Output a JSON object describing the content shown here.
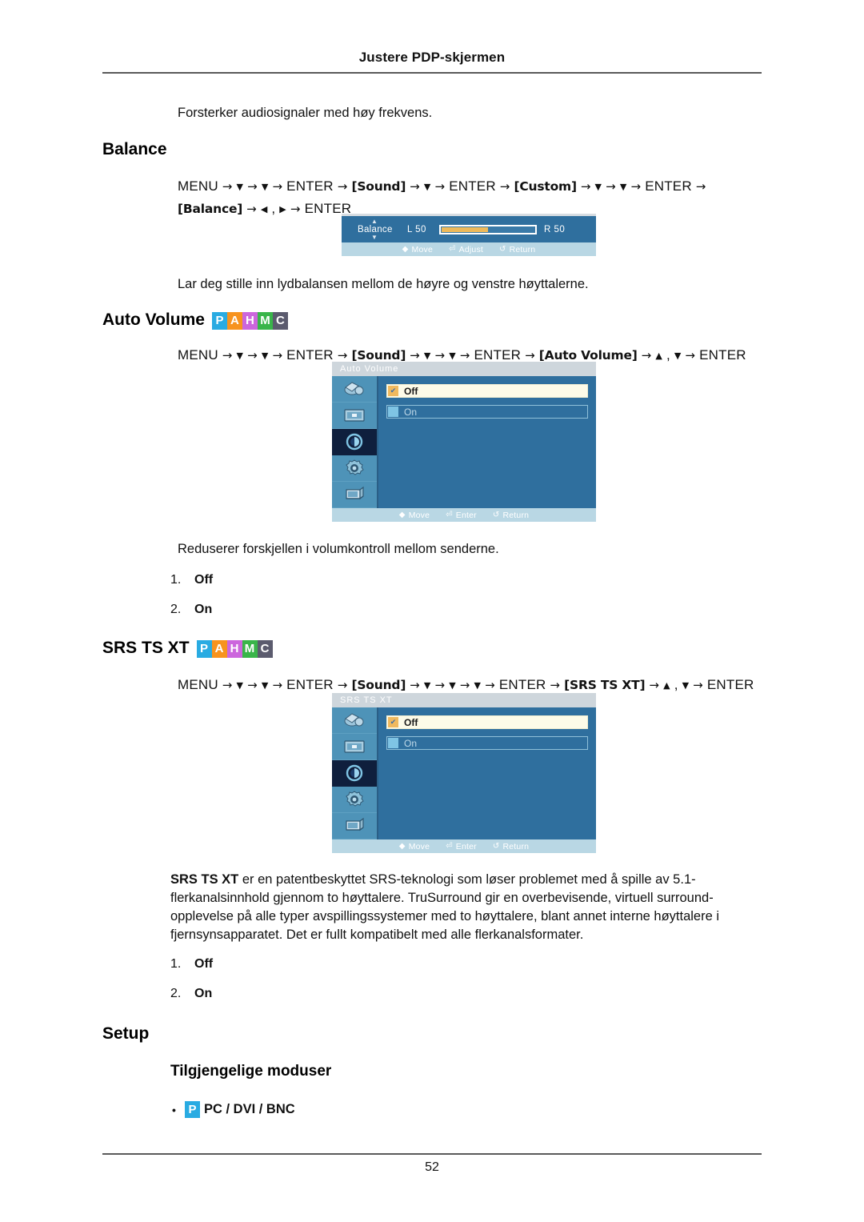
{
  "page": {
    "running_head": "Justere PDP-skjermen",
    "page_number": "52"
  },
  "intro": {
    "text": "Forsterker audiosignaler med høy frekvens."
  },
  "badges": {
    "items": [
      {
        "letter": "P",
        "color": "#29abe2"
      },
      {
        "letter": "A",
        "color": "#f7931e"
      },
      {
        "letter": "H",
        "color": "#cc66dd"
      },
      {
        "letter": "M",
        "color": "#39b54a"
      },
      {
        "letter": "C",
        "color": "#5b5b6e"
      }
    ]
  },
  "balance": {
    "heading": "Balance",
    "path_line1": [
      {
        "t": "MENU",
        "k": "word"
      },
      {
        "t": "→",
        "k": "arr"
      },
      {
        "t": "▼",
        "k": "dn"
      },
      {
        "t": "→",
        "k": "arr"
      },
      {
        "t": "▼",
        "k": "dn"
      },
      {
        "t": "→",
        "k": "arr"
      },
      {
        "t": "ENTER",
        "k": "word"
      },
      {
        "t": "→",
        "k": "arr"
      },
      {
        "t": "[Sound]",
        "k": "tok"
      },
      {
        "t": "→",
        "k": "arr"
      },
      {
        "t": "▼",
        "k": "dn"
      },
      {
        "t": "→",
        "k": "arr"
      },
      {
        "t": "ENTER",
        "k": "word"
      },
      {
        "t": "→",
        "k": "arr"
      },
      {
        "t": "[Custom]",
        "k": "tok"
      },
      {
        "t": "→",
        "k": "arr"
      },
      {
        "t": "▼",
        "k": "dn"
      },
      {
        "t": "→",
        "k": "arr"
      },
      {
        "t": "▼",
        "k": "dn"
      },
      {
        "t": "→",
        "k": "arr"
      },
      {
        "t": "ENTER",
        "k": "word"
      },
      {
        "t": "→",
        "k": "arr"
      }
    ],
    "path_line2": [
      {
        "t": "[Balance]",
        "k": "tok"
      },
      {
        "t": "→",
        "k": "arr"
      },
      {
        "t": "◀",
        "k": "lr"
      },
      {
        "t": ",",
        "k": "word"
      },
      {
        "t": "▶",
        "k": "lr"
      },
      {
        "t": "→",
        "k": "arr"
      },
      {
        "t": "ENTER",
        "k": "word"
      }
    ],
    "osd": {
      "label": "Balance",
      "left_label": "L  50",
      "right_label": "R  50",
      "fill_percent": 50,
      "footer": [
        {
          "glyph": "◆",
          "label": "Move"
        },
        {
          "glyph": "⏎",
          "label": "Adjust"
        },
        {
          "glyph": "↺",
          "label": "Return"
        }
      ]
    },
    "description": "Lar deg stille inn lydbalansen mellom de høyre og venstre høyttalerne."
  },
  "auto_volume": {
    "heading": "Auto Volume",
    "path": [
      {
        "t": "MENU",
        "k": "word"
      },
      {
        "t": "→",
        "k": "arr"
      },
      {
        "t": "▼",
        "k": "dn"
      },
      {
        "t": "→",
        "k": "arr"
      },
      {
        "t": "▼",
        "k": "dn"
      },
      {
        "t": "→",
        "k": "arr"
      },
      {
        "t": "ENTER",
        "k": "word"
      },
      {
        "t": "→",
        "k": "arr"
      },
      {
        "t": "[Sound]",
        "k": "tok"
      },
      {
        "t": "→",
        "k": "arr"
      },
      {
        "t": "▼",
        "k": "dn"
      },
      {
        "t": "→",
        "k": "arr"
      },
      {
        "t": "▼",
        "k": "dn"
      },
      {
        "t": "→",
        "k": "arr"
      },
      {
        "t": "ENTER",
        "k": "word"
      },
      {
        "t": "→",
        "k": "arr"
      },
      {
        "t": "[Auto Volume]",
        "k": "tok"
      },
      {
        "t": "→",
        "k": "arr"
      },
      {
        "t": "▲",
        "k": "up"
      },
      {
        "t": ",",
        "k": "word"
      },
      {
        "t": "▼",
        "k": "dn"
      },
      {
        "t": "→",
        "k": "arr"
      },
      {
        "t": "ENTER",
        "k": "word"
      }
    ],
    "osd": {
      "title": "Auto Volume",
      "options": [
        {
          "label": "Off",
          "selected": true
        },
        {
          "label": "On",
          "selected": false
        }
      ],
      "footer": [
        {
          "glyph": "◆",
          "label": "Move"
        },
        {
          "glyph": "⏎",
          "label": "Enter"
        },
        {
          "glyph": "↺",
          "label": "Return"
        }
      ],
      "rail_icons": [
        "picture-icon",
        "image-icon",
        "sound-icon",
        "setup-icon",
        "multi-control-icon"
      ],
      "rail_active_index": 2
    },
    "description": "Reduserer forskjellen i volumkontroll mellom senderne.",
    "list": [
      {
        "n": "1.",
        "t": "Off"
      },
      {
        "n": "2.",
        "t": "On"
      }
    ]
  },
  "srs": {
    "heading": "SRS TS XT",
    "path": [
      {
        "t": "MENU",
        "k": "word"
      },
      {
        "t": "→",
        "k": "arr"
      },
      {
        "t": "▼",
        "k": "dn"
      },
      {
        "t": "→",
        "k": "arr"
      },
      {
        "t": "▼",
        "k": "dn"
      },
      {
        "t": "→",
        "k": "arr"
      },
      {
        "t": "ENTER",
        "k": "word"
      },
      {
        "t": "→",
        "k": "arr"
      },
      {
        "t": "[Sound]",
        "k": "tok"
      },
      {
        "t": "→",
        "k": "arr"
      },
      {
        "t": "▼",
        "k": "dn"
      },
      {
        "t": "→",
        "k": "arr"
      },
      {
        "t": "▼",
        "k": "dn"
      },
      {
        "t": "→",
        "k": "arr"
      },
      {
        "t": "▼",
        "k": "dn"
      },
      {
        "t": "→",
        "k": "arr"
      },
      {
        "t": "ENTER",
        "k": "word"
      },
      {
        "t": "→",
        "k": "arr"
      },
      {
        "t": "[SRS TS XT]",
        "k": "tok"
      },
      {
        "t": "→",
        "k": "arr"
      },
      {
        "t": "▲",
        "k": "up"
      },
      {
        "t": ",",
        "k": "word"
      },
      {
        "t": "▼",
        "k": "dn"
      },
      {
        "t": "→",
        "k": "arr"
      },
      {
        "t": "ENTER",
        "k": "word"
      }
    ],
    "osd": {
      "title": "SRS TS XT",
      "options": [
        {
          "label": "Off",
          "selected": true
        },
        {
          "label": "On",
          "selected": false
        }
      ],
      "footer": [
        {
          "glyph": "◆",
          "label": "Move"
        },
        {
          "glyph": "⏎",
          "label": "Enter"
        },
        {
          "glyph": "↺",
          "label": "Return"
        }
      ],
      "rail_icons": [
        "picture-icon",
        "image-icon",
        "sound-icon",
        "setup-icon",
        "multi-control-icon"
      ],
      "rail_active_index": 2
    },
    "description_bold": "SRS TS XT",
    "description_rest": " er en patentbeskyttet SRS-teknologi som løser problemet med å spille av 5.1-flerkanalsinnhold gjennom to høyttalere. TruSurround gir en overbevisende, virtuell surround-opplevelse på alle typer avspillingssystemer med to høyttalere, blant annet interne høyttalere i fjernsynsapparatet. Det er fullt kompatibelt med alle flerkanalsformater.",
    "list": [
      {
        "n": "1.",
        "t": "Off"
      },
      {
        "n": "2.",
        "t": "On"
      }
    ]
  },
  "setup": {
    "heading": "Setup",
    "subheading": "Tilgjengelige moduser",
    "bullet": {
      "dot": "•",
      "badge_letter": "P",
      "badge_color": "#29abe2",
      "label": "PC / DVI / BNC"
    }
  }
}
